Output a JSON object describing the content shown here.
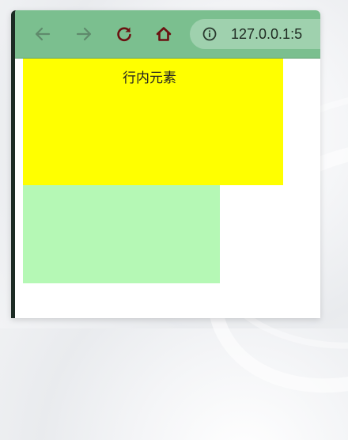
{
  "browser": {
    "url": "127.0.0.1:5",
    "icons": {
      "back": "back-arrow-icon",
      "forward": "forward-arrow-icon",
      "reload": "reload-icon",
      "home": "home-icon",
      "info": "info-icon"
    },
    "colors": {
      "toolbar": "#7bbf8f",
      "nav_disabled": "#5f8a6c",
      "nav_active": "#6b1010"
    }
  },
  "page": {
    "inline_element_text": "行内元素",
    "colors": {
      "yellow_block": "#ffff00",
      "green_block": "#b5f8b5"
    }
  }
}
